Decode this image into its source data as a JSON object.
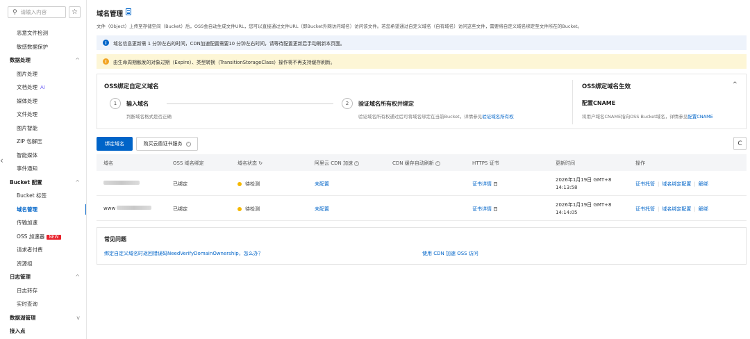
{
  "sidebar": {
    "search_placeholder": "请输入内容",
    "star_glyph": "☆",
    "items": [
      {
        "label": "恶意文件检测",
        "kind": "sub"
      },
      {
        "label": "敏感数据保护",
        "kind": "sub"
      },
      {
        "label": "数据处理",
        "kind": "group",
        "chevron": "^"
      },
      {
        "label": "图片处理",
        "kind": "sub"
      },
      {
        "label": "文档处理",
        "kind": "sub",
        "badge": "AI"
      },
      {
        "label": "媒体处理",
        "kind": "sub"
      },
      {
        "label": "文件处理",
        "kind": "sub"
      },
      {
        "label": "图片智能",
        "kind": "sub"
      },
      {
        "label": "ZIP 包解压",
        "kind": "sub"
      },
      {
        "label": "智能媒体",
        "kind": "sub"
      },
      {
        "label": "事件通知",
        "kind": "sub"
      },
      {
        "label": "Bucket 配置",
        "kind": "group",
        "chevron": "^"
      },
      {
        "label": "Bucket 标签",
        "kind": "sub"
      },
      {
        "label": "域名管理",
        "kind": "sub",
        "active": true
      },
      {
        "label": "传输加速",
        "kind": "sub"
      },
      {
        "label": "OSS 加速器",
        "kind": "sub",
        "new_badge": "NEW"
      },
      {
        "label": "请求者付费",
        "kind": "sub"
      },
      {
        "label": "资源组",
        "kind": "sub"
      },
      {
        "label": "日志管理",
        "kind": "group",
        "chevron": "^"
      },
      {
        "label": "日志转存",
        "kind": "sub"
      },
      {
        "label": "实时查询",
        "kind": "sub"
      },
      {
        "label": "数据湖管理",
        "kind": "group",
        "chevron": "v"
      },
      {
        "label": "接入点",
        "kind": "group"
      }
    ]
  },
  "page": {
    "title": "域名管理",
    "description": "文件（Object）上传至存储空间（Bucket）后，OSS会自动生成文件URL，您可以直接通过文件URL（即Bucket外网访问域名）访问该文件。若您希望通过自定义域名（自有域名）访问这些文件，需要将自定义域名绑定至文件所在的Bucket。"
  },
  "alerts": {
    "info": "域名信息更新需 1 分钟左右的时间，CDN加速配置需要10 分钟左右时间，请等待配置更新后手动刷新本页面。",
    "warn": "由生命周期触发的对象过期（Expire）、类型转换（TransitionStorageClass）操作将不再支持缓存刷新。"
  },
  "steps": {
    "title": "OSS绑定自定义域名",
    "step1": {
      "num": "1",
      "name": "输入域名",
      "desc": "判断域名格式是否正确"
    },
    "step2": {
      "num": "2",
      "name": "验证域名所有权并绑定",
      "desc": "验证域名所有权通过后可将域名绑定在当前Bucket，详情参见",
      "link": "验证域名所有权"
    },
    "right": {
      "title": "OSS绑定域名生效",
      "subtitle": "配置CNAME",
      "desc": "将用户域名CNAME指向OSS Bucket域名，详情参见",
      "link": "配置CNAME"
    },
    "collapse_glyph": "^"
  },
  "toolbar": {
    "bind_label": "绑定域名",
    "buy_cert_label": "购买云盾证书服务",
    "refresh_glyph": "C"
  },
  "table": {
    "headers": [
      "域名",
      "OSS 域名绑定",
      "域名状态",
      "阿里云 CDN 加速",
      "CDN 缓存自动刷新",
      "HTTPS 证书",
      "更新时间",
      "操作"
    ],
    "rows": [
      {
        "domain_prefix": "",
        "binding": "已绑定",
        "status": "待检测",
        "cdn": "未配置",
        "cert": "证书详情",
        "time_line1": "2026年1月19日 GMT+8",
        "time_line2": "14:13:58",
        "actions": [
          "证书托管",
          "域名绑定配置",
          "解绑"
        ]
      },
      {
        "domain_prefix": "www",
        "binding": "已绑定",
        "status": "待检测",
        "cdn": "未配置",
        "cert": "证书详情",
        "time_line1": "2026年1月19日 GMT+8",
        "time_line2": "14:14:05",
        "actions": [
          "证书托管",
          "域名绑定配置",
          "解绑"
        ]
      }
    ]
  },
  "faq": {
    "title": "常见问题",
    "links": [
      "绑定自定义域名时返回错误码NeedVerifyDomainOwnership，怎么办？",
      "使用 CDN 加速 OSS 访问"
    ]
  },
  "colors": {
    "accent": "#0064c8",
    "pending": "#f5b800",
    "warn": "#f2a320",
    "new_badge": "#e8202a"
  }
}
